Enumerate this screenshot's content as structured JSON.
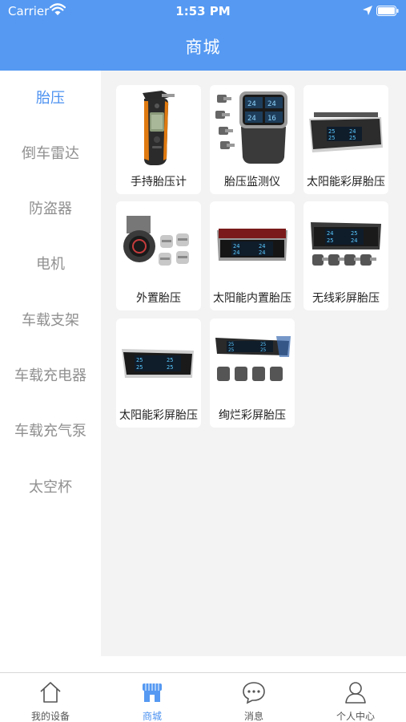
{
  "status_bar": {
    "carrier": "Carrier",
    "time": "1:53 PM"
  },
  "nav": {
    "title": "商城"
  },
  "sidebar": {
    "items": [
      {
        "label": "胎压",
        "active": true
      },
      {
        "label": "倒车雷达",
        "active": false
      },
      {
        "label": "防盗器",
        "active": false
      },
      {
        "label": "电机",
        "active": false
      },
      {
        "label": "车载支架",
        "active": false
      },
      {
        "label": "车载充电器",
        "active": false
      },
      {
        "label": "车载充气泵",
        "active": false
      },
      {
        "label": "太空杯",
        "active": false
      }
    ]
  },
  "products": [
    {
      "label": "手持胎压计",
      "icon": "handheld-gauge-image"
    },
    {
      "label": "胎压监测仪",
      "icon": "tpms-monitor-image"
    },
    {
      "label": "太阳能彩屏胎压",
      "icon": "solar-color-screen-image"
    },
    {
      "label": "外置胎压",
      "icon": "external-sensor-image"
    },
    {
      "label": "太阳能内置胎压",
      "icon": "solar-internal-image"
    },
    {
      "label": "无线彩屏胎压",
      "icon": "wireless-color-screen-image"
    },
    {
      "label": "太阳能彩屏胎压",
      "icon": "solar-color-screen-2-image"
    },
    {
      "label": "绚烂彩屏胎压",
      "icon": "brilliant-color-screen-image"
    }
  ],
  "tabbar": {
    "items": [
      {
        "label": "我的设备",
        "icon": "home-icon",
        "active": false
      },
      {
        "label": "商城",
        "icon": "store-icon",
        "active": true
      },
      {
        "label": "消息",
        "icon": "message-icon",
        "active": false
      },
      {
        "label": "个人中心",
        "icon": "person-icon",
        "active": false
      }
    ]
  },
  "colors": {
    "accent": "#5599f2",
    "active_text": "#4a90f0",
    "inactive_text": "#909090",
    "content_bg": "#f3f3f3"
  }
}
